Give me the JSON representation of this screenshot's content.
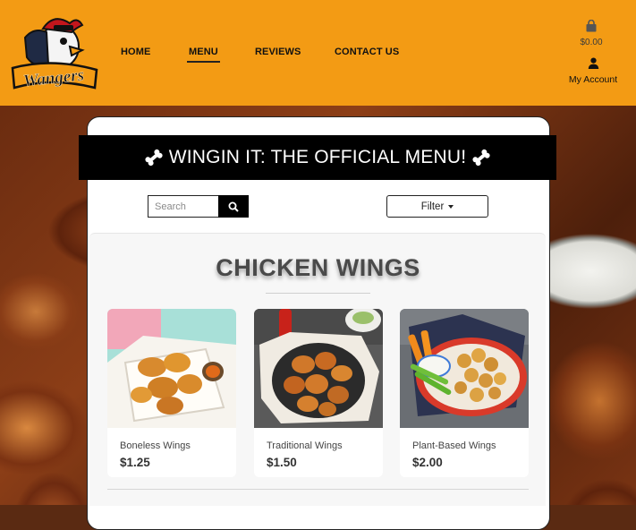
{
  "brand": {
    "logo_text": "Wangers"
  },
  "nav": {
    "items": [
      {
        "label": "HOME",
        "active": false
      },
      {
        "label": "MENU",
        "active": true
      },
      {
        "label": "REVIEWS",
        "active": false
      },
      {
        "label": "CONTACT US",
        "active": false
      }
    ]
  },
  "cart": {
    "icon": "shopping-bag-icon",
    "total": "$0.00"
  },
  "account": {
    "icon": "user-icon",
    "label": "My Account"
  },
  "banner": {
    "title": "WINGIN IT: THE OFFICIAL MENU!",
    "icon": "bone-icon"
  },
  "search": {
    "placeholder": "Search",
    "value": "",
    "button_icon": "search-icon"
  },
  "filter": {
    "label": "Filter"
  },
  "section": {
    "title": "CHICKEN WINGS",
    "items": [
      {
        "name": "Boneless Wings",
        "price": "$1.25"
      },
      {
        "name": "Traditional Wings",
        "price": "$1.50"
      },
      {
        "name": "Plant-Based Wings",
        "price": "$2.00"
      }
    ]
  },
  "colors": {
    "header": "#f39b14",
    "banner": "#000000",
    "accent_text": "#4a4a4a"
  }
}
